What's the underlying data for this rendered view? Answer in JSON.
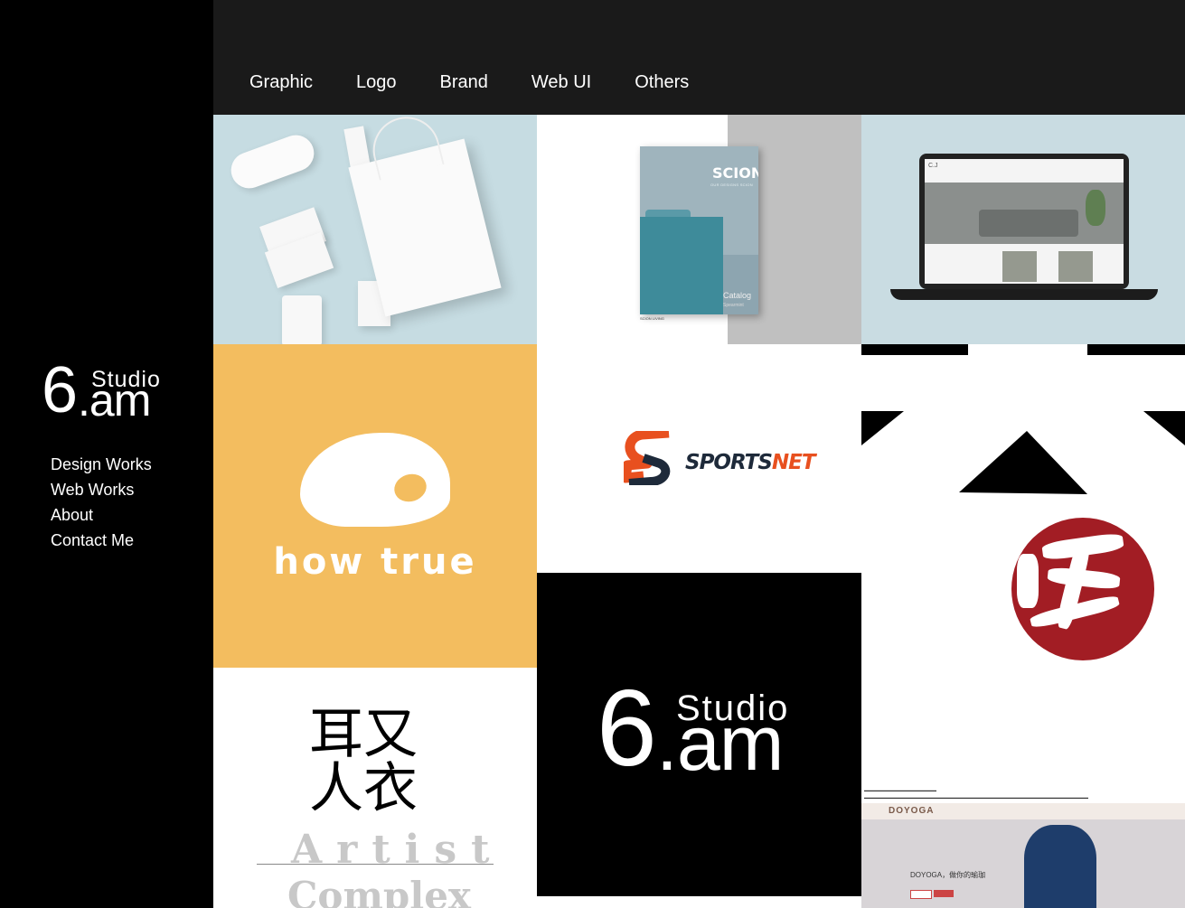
{
  "brand": {
    "six": "6",
    "studio": "Studio",
    "am": ".am"
  },
  "sidebar": {
    "items": [
      {
        "label": "Design Works"
      },
      {
        "label": "Web Works"
      },
      {
        "label": "About"
      },
      {
        "label": "Contact Me"
      }
    ]
  },
  "topnav": {
    "items": [
      {
        "label": "Graphic"
      },
      {
        "label": "Logo"
      },
      {
        "label": "Brand"
      },
      {
        "label": "Web UI"
      },
      {
        "label": "Others"
      }
    ]
  },
  "works": {
    "scion": {
      "name": "SCION",
      "sub": "OUR DESIGNS SCION",
      "catalog": "Catalog",
      "catalog_sub": "Spearmint",
      "living": "SCION LIVING"
    },
    "howtrue": {
      "name": "how true"
    },
    "sportsnet": {
      "sports": "SPORTS",
      "net": "NET"
    },
    "calligraphy": {
      "chars": "耳又\n人衣",
      "artist": "Artist",
      "complex": "Complex"
    },
    "studio_logo": {
      "six": "6",
      "studio": "Studio",
      "am": ".am"
    },
    "doyoga": {
      "brand": "DOYOGA",
      "slogan": "DOYOGA，做你的瑜珈"
    }
  },
  "colors": {
    "sidebar_bg": "#000000",
    "topbar_bg": "#1a1a1a",
    "howtrue_bg": "#f3bd5f",
    "sportsnet_accent": "#e8501f",
    "brush_red": "#a21d24"
  }
}
